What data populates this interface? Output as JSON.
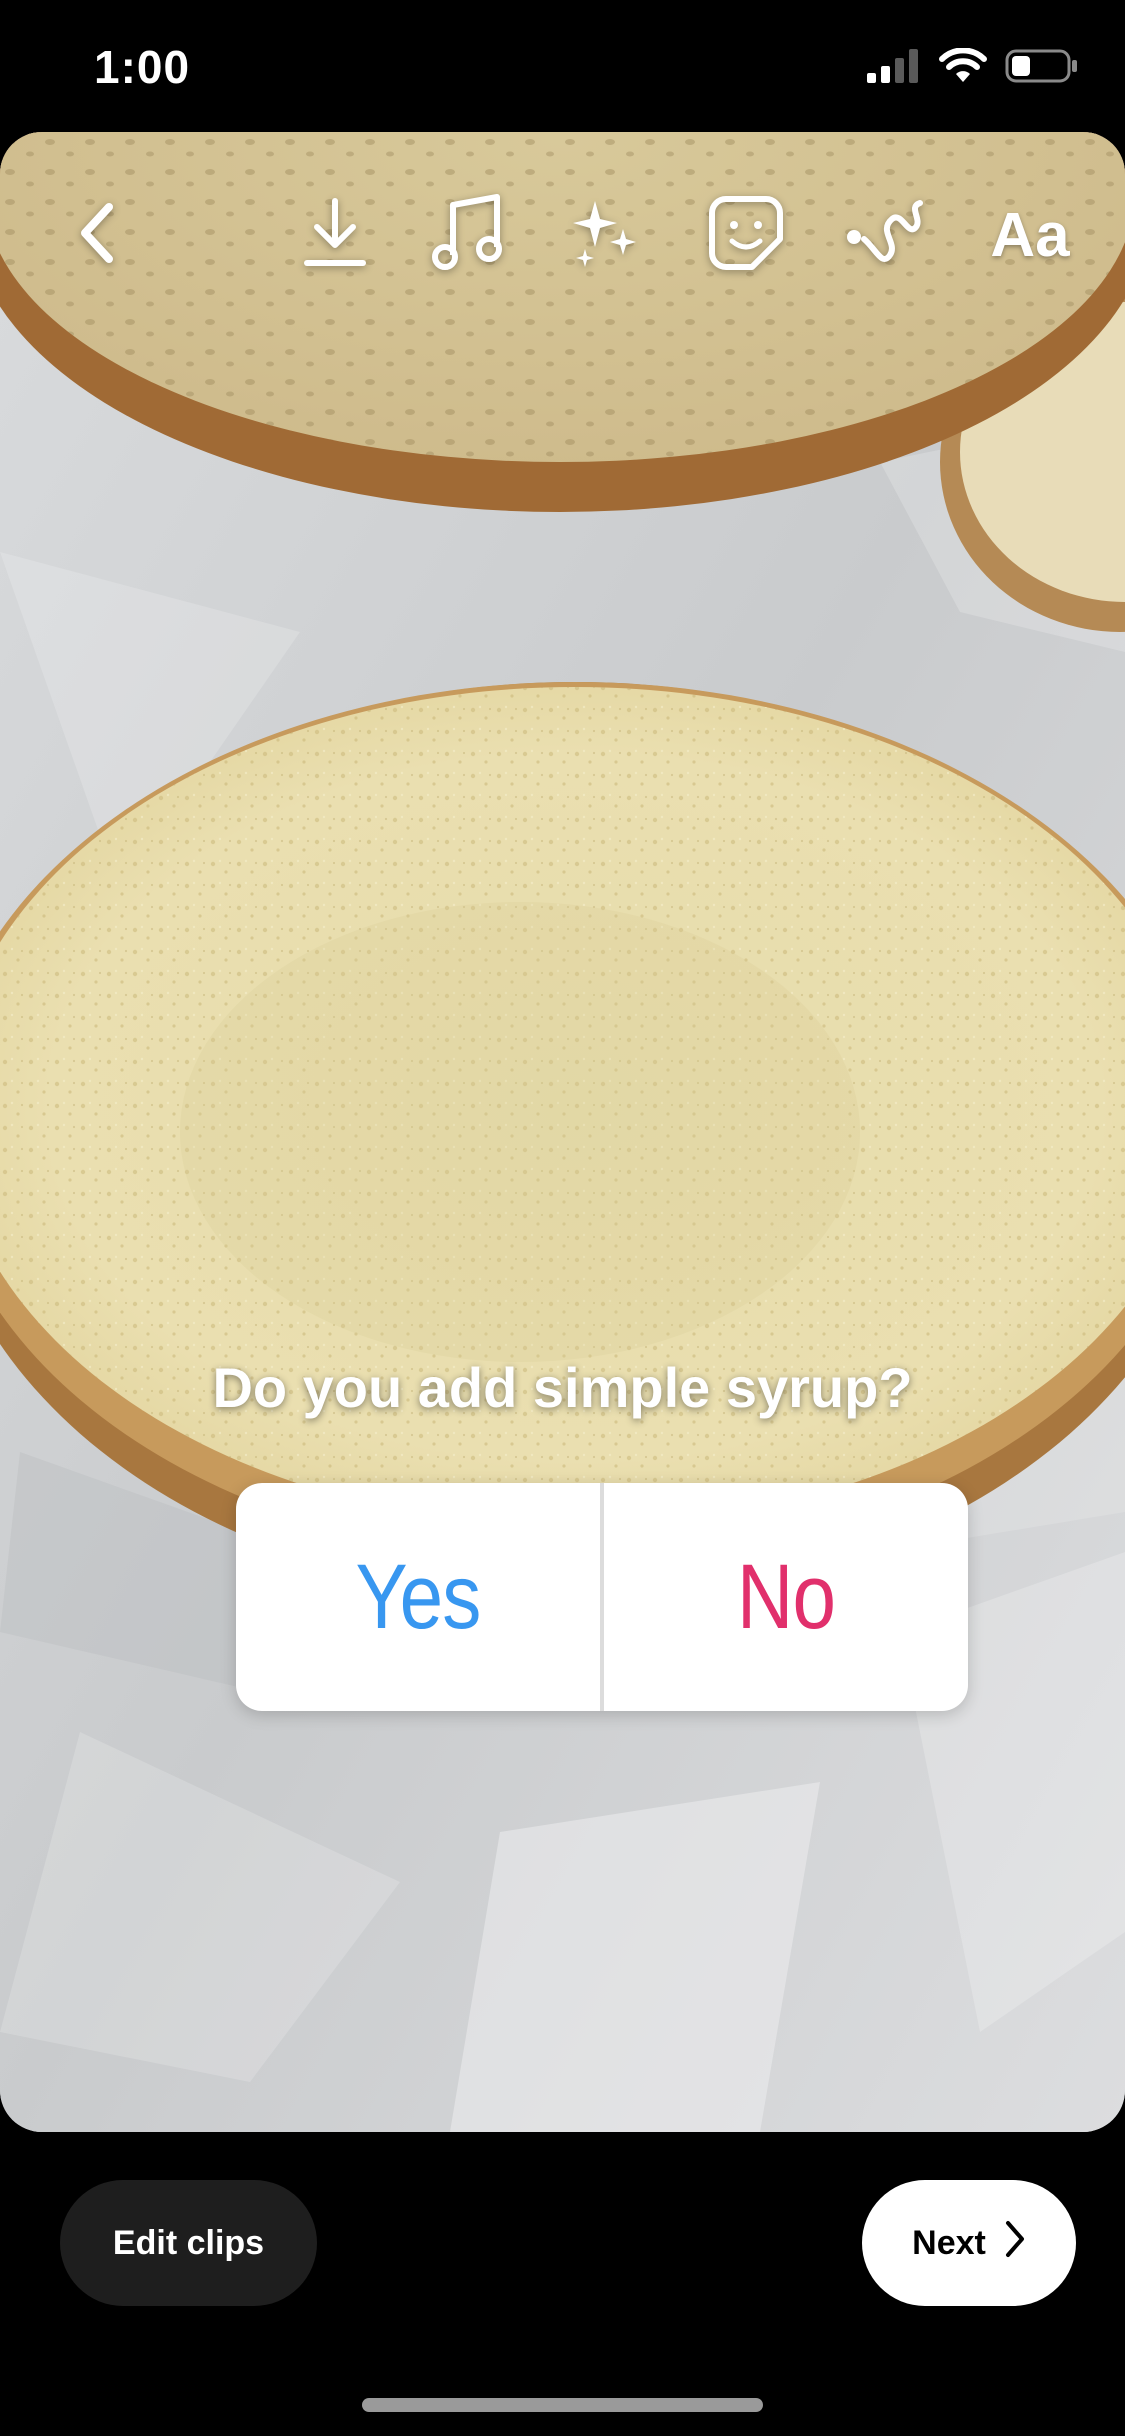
{
  "status_bar": {
    "time": "1:00",
    "icons": [
      "cellular-signal-icon",
      "wifi-icon",
      "battery-icon"
    ]
  },
  "toolbar": {
    "back_icon": "chevron-left-icon",
    "download_icon": "download-icon",
    "music_icon": "music-note-icon",
    "effects_icon": "sparkles-icon",
    "sticker_icon": "sticker-icon",
    "draw_icon": "scribble-icon",
    "text_label": "Aa"
  },
  "poll": {
    "question": "Do you add simple syrup?",
    "options": [
      {
        "label": "Yes",
        "color": "#3897f0"
      },
      {
        "label": "No",
        "color": "#e1306c"
      }
    ]
  },
  "bottom": {
    "edit_clips_label": "Edit clips",
    "next_label": "Next",
    "next_icon": "chevron-right-icon"
  },
  "colors": {
    "background": "#000000",
    "poll_yes": "#3897f0",
    "poll_no": "#e1306c"
  }
}
